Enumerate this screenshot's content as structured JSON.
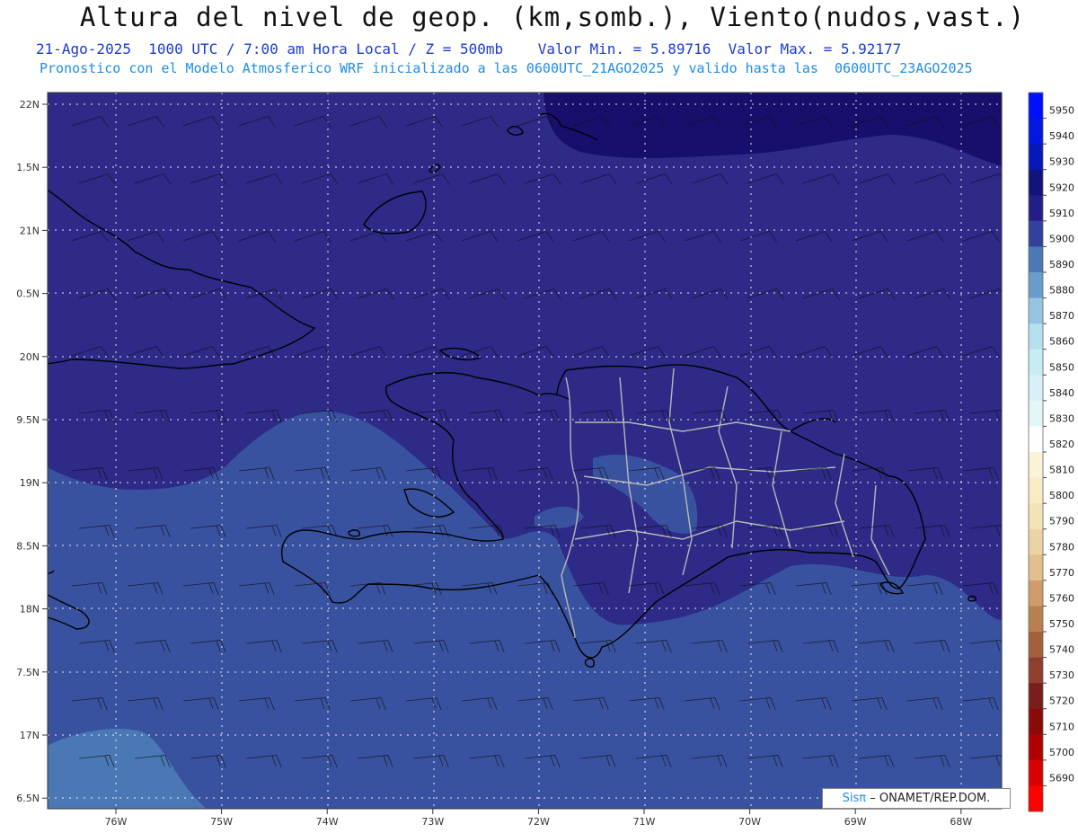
{
  "title": "Altura del nivel de geop. (km,somb.), Viento(nudos,vast.)",
  "subtitle_date": "21-Ago-2025",
  "subtitle_time": "1000 UTC / 7:00 am Hora Local / Z = 500mb",
  "subtitle_min": "Valor Min. = 5.89716",
  "subtitle_max": "Valor Max. = 5.92177",
  "subtitle_model": "Pronostico con el Modelo Atmosferico WRF inicializado a las 0600UTC_21AGO2025 y valido hasta las  0600UTC_23AGO2025",
  "lat_labels": [
    "22N",
    "1.5N",
    "21N",
    "0.5N",
    "20N",
    "9.5N",
    "19N",
    "8.5N",
    "18N",
    "7.5N",
    "17N",
    "6.5N"
  ],
  "lon_labels": [
    "76W",
    "75W",
    "74W",
    "73W",
    "72W",
    "71W",
    "70W",
    "69W",
    "68W"
  ],
  "colorbar": {
    "labels": [
      "5950",
      "5940",
      "5930",
      "5920",
      "5910",
      "5900",
      "5890",
      "5880",
      "5870",
      "5860",
      "5850",
      "5840",
      "5830",
      "5820",
      "5810",
      "5800",
      "5790",
      "5780",
      "5770",
      "5760",
      "5750",
      "5740",
      "5730",
      "5720",
      "5710",
      "5700",
      "5690"
    ],
    "colors": [
      "#0010ff",
      "#0018e0",
      "#0618b8",
      "#12137a",
      "#231e86",
      "#33419b",
      "#4b79b4",
      "#6a9ccb",
      "#95c4e0",
      "#b7e0ee",
      "#c8ecf4",
      "#d7f1f7",
      "#e3f6f8",
      "#fffefe",
      "#fbf3d8",
      "#f8ecc6",
      "#f4e3b6",
      "#ecd3a4",
      "#e2c08d",
      "#cf9d69",
      "#b9804f",
      "#a3603d",
      "#8f3e30",
      "#7a1d1d",
      "#8a0a0a",
      "#b00000",
      "#d60000",
      "#ff0000"
    ]
  },
  "map_colors": {
    "c5920": "#170f6b",
    "c5910": "#2d2a88",
    "c5900": "#3952a0",
    "c5890": "#4a78b5"
  },
  "credit": {
    "brand": "Sisπ",
    "text": "– ONAMET/REP.DOM."
  }
}
